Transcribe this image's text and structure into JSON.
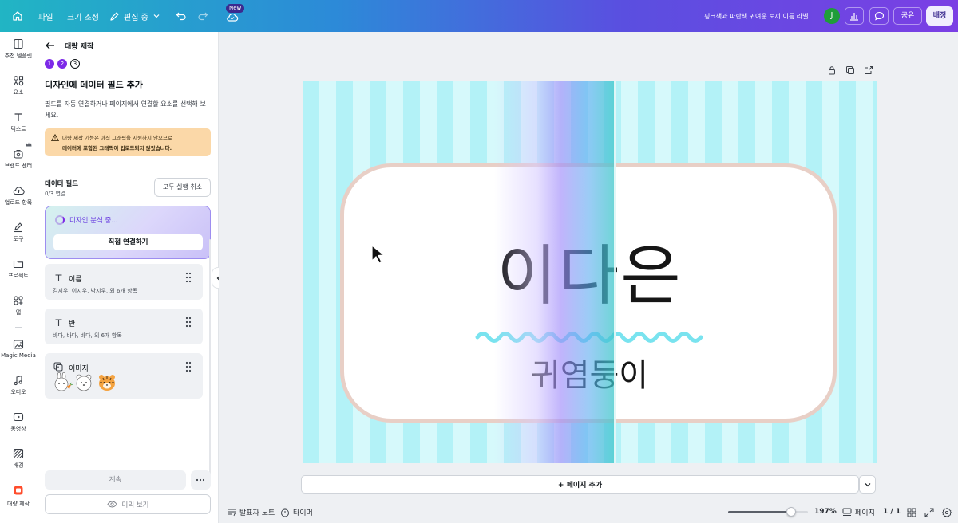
{
  "topbar": {
    "file": "파일",
    "resize": "크기 조정",
    "editing": "편집 중",
    "new_badge": "New",
    "doc_title": "핑크색과 파란색 귀여운 토끼 이름 라벨",
    "avatar_initial": "J",
    "share": "공유",
    "publish": "배정"
  },
  "rail": [
    {
      "label": "추천 템플릿",
      "icon": "template-icon"
    },
    {
      "label": "요소",
      "icon": "elements-icon"
    },
    {
      "label": "텍스트",
      "icon": "text-icon"
    },
    {
      "label": "브랜드 센터",
      "icon": "brand-icon"
    },
    {
      "label": "업로드 항목",
      "icon": "upload-icon"
    },
    {
      "label": "도구",
      "icon": "draw-icon"
    },
    {
      "label": "프로젝트",
      "icon": "folder-icon"
    },
    {
      "label": "앱",
      "icon": "apps-icon"
    },
    {
      "label": "Magic Media",
      "icon": "magic-media-icon"
    },
    {
      "label": "오디오",
      "icon": "audio-icon"
    },
    {
      "label": "동영상",
      "icon": "video-icon"
    },
    {
      "label": "배경",
      "icon": "background-icon"
    },
    {
      "label": "대량 제작",
      "icon": "bulk-create-icon"
    }
  ],
  "panel": {
    "back_title": "대량 제작",
    "steps": [
      "1",
      "2",
      "3"
    ],
    "heading": "디자인에 데이터 필드 추가",
    "desc": "필드를 자동 연결하거나 페이지에서 연결할 요소를 선택해 보세요.",
    "warning_line1": "대량 제작 기능은 아직 그래픽을 지원하지 않으므로",
    "warning_line2": "데이터에 포함된 그래픽이 업로드되지 않았습니다.",
    "data_fields_label": "데이터 필드",
    "connected_count": "0/3 연결",
    "undo_all": "모두 실행 취소",
    "analyzing": "디자인 분석 중...",
    "connect_manually": "직접 연결하기",
    "fields": [
      {
        "name": "이름",
        "desc": "김지우, 이지우, 박지우, 외 6개 항목"
      },
      {
        "name": "반",
        "desc": "바다, 바다, 바다, 외 6개 항목"
      },
      {
        "name": "이미지",
        "desc": ""
      }
    ],
    "continue": "계속",
    "preview": "미리 보기"
  },
  "design": {
    "name_text": "이다은",
    "subtitle_text": "귀염둥이"
  },
  "canvas": {
    "add_page": "+ 페이지 추가"
  },
  "bottombar": {
    "presenter_notes": "발표자 노트",
    "timer": "타이머",
    "zoom": "197%",
    "zoom_fraction": 0.79,
    "pages_label": "페이지",
    "page_count": "1 / 1"
  },
  "colors": {
    "accent": "#7d2ae8",
    "stripe_light": "#d6f9fb",
    "stripe_dark": "#b3f2f7",
    "border_pink": "#e8cfc6",
    "wave": "#79e3ef"
  }
}
